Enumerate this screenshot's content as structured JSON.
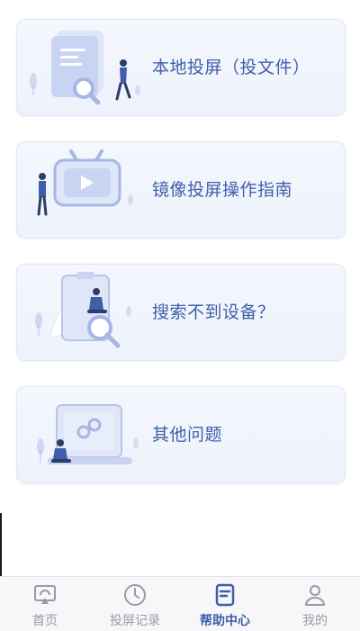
{
  "cards": [
    {
      "title": "本地投屏（投文件）"
    },
    {
      "title": "镜像投屏操作指南"
    },
    {
      "title": "搜索不到设备？"
    },
    {
      "title": "其他问题"
    }
  ],
  "tabbar": {
    "active_index": 2,
    "tabs": [
      {
        "label": "首页",
        "icon": "cast-screen-icon"
      },
      {
        "label": "投屏记录",
        "icon": "clock-icon"
      },
      {
        "label": "帮助中心",
        "icon": "document-icon"
      },
      {
        "label": "我的",
        "icon": "user-icon"
      }
    ]
  },
  "colors": {
    "accent": "#3f5fa9",
    "tab_inactive": "#9a9aa2",
    "card_bg": "#f1f5fc",
    "illus_blue": "#c9d4f2"
  }
}
